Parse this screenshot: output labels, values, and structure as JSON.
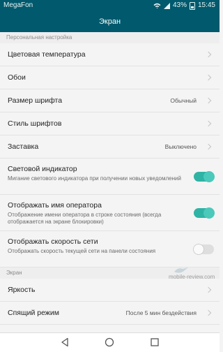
{
  "status_bar": {
    "carrier": "MegaFon",
    "battery": "43%",
    "time": "15:45",
    "icons": [
      "wifi-icon",
      "signal-icon",
      "battery-icon"
    ]
  },
  "title": "Экран",
  "sections": [
    {
      "header": "Персональная настройка",
      "items": [
        {
          "type": "link",
          "title": "Цветовая температура",
          "value": ""
        },
        {
          "type": "link",
          "title": "Обои",
          "value": ""
        },
        {
          "type": "link",
          "title": "Размер шрифта",
          "value": "Обычный"
        },
        {
          "type": "link",
          "title": "Стиль шрифтов",
          "value": ""
        },
        {
          "type": "link",
          "title": "Заставка",
          "value": "Выключено"
        },
        {
          "type": "toggle",
          "title": "Световой индикатор",
          "desc": "Мигание светового индикатора при получении новых уведомлений",
          "on": true
        },
        {
          "type": "toggle",
          "title": "Отображать имя оператора",
          "desc": "Отображение имени оператора в строке состояния (всегда отображается на экране блокировки)",
          "on": true
        },
        {
          "type": "toggle",
          "title": "Отображать скорость сети",
          "desc": "Отображать скорость текущей сети на панели состояния",
          "on": false
        }
      ]
    },
    {
      "header": "Экран",
      "items": [
        {
          "type": "link",
          "title": "Яркость",
          "value": ""
        },
        {
          "type": "link",
          "title": "Спящий режим",
          "value": "После 5 мин бездействия"
        }
      ]
    }
  ],
  "watermark": "mobile-review.com",
  "nav": [
    "back-icon",
    "home-icon",
    "recents-icon"
  ],
  "colors": {
    "header_bg": "#00596c",
    "toggle_on": "#2fb3a4"
  }
}
